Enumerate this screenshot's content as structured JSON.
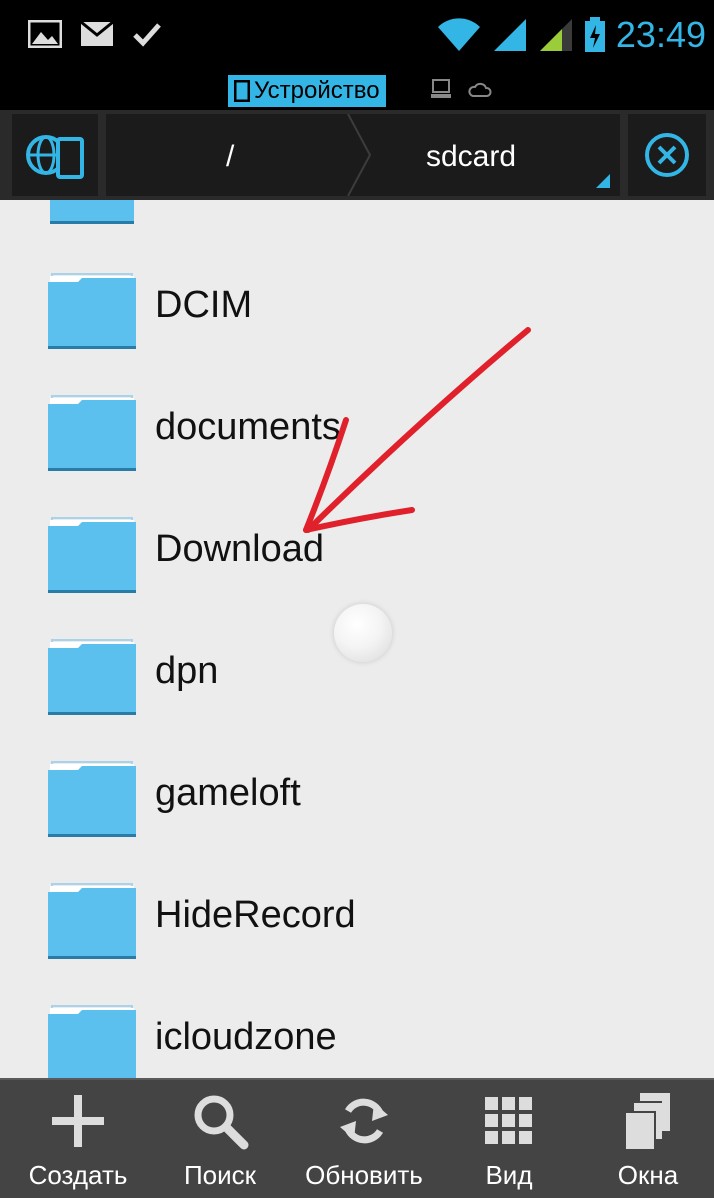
{
  "status_bar": {
    "time": "23:49",
    "left_icons": [
      "image-icon",
      "mail-icon",
      "check-icon"
    ],
    "right_icons": [
      "wifi-icon",
      "signal-icon",
      "signal-icon-2",
      "battery-charging-icon"
    ]
  },
  "location_bar": {
    "device_label": "Устройство"
  },
  "nav": {
    "root": "/",
    "current": "sdcard"
  },
  "folders": [
    {
      "name": "DCIM"
    },
    {
      "name": "documents"
    },
    {
      "name": "Download"
    },
    {
      "name": "dpn"
    },
    {
      "name": "gameloft"
    },
    {
      "name": "HideRecord"
    },
    {
      "name": "icloudzone"
    }
  ],
  "toolbar": {
    "create": "Создать",
    "search": "Поиск",
    "refresh": "Обновить",
    "view": "Вид",
    "windows": "Окна"
  },
  "colors": {
    "accent": "#33b5e5",
    "folder": "#5bc0ee",
    "annotation": "#e0202a"
  }
}
